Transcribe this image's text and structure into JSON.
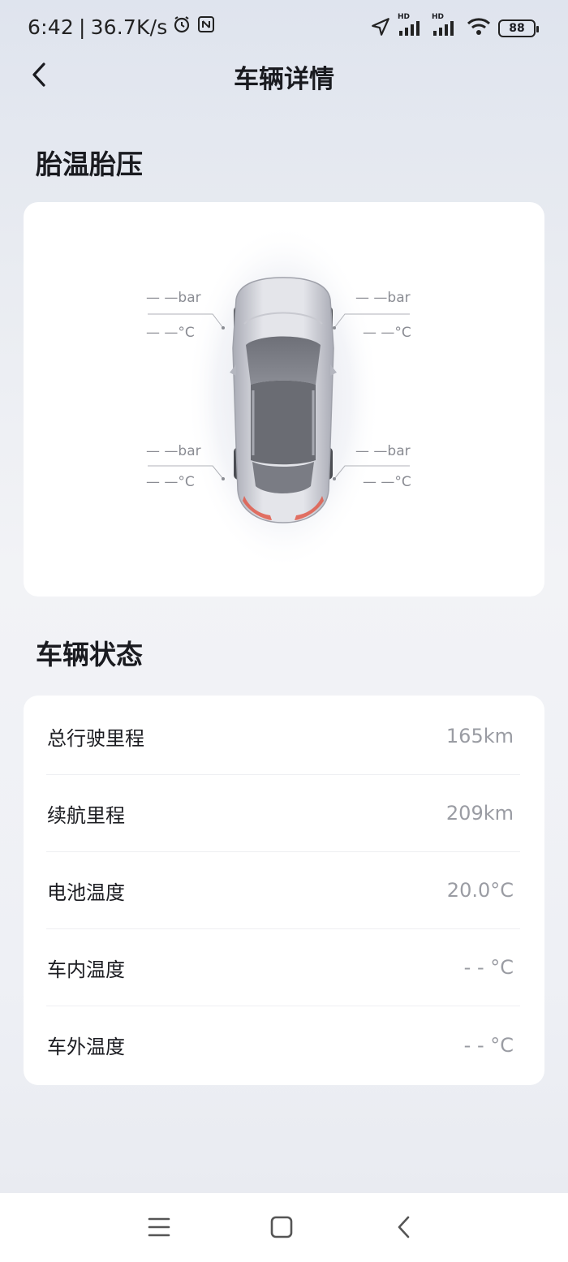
{
  "status_bar": {
    "time": "6:42",
    "net_speed": "36.7K/s",
    "battery": "88",
    "signal_badge_1": "HD",
    "signal_badge_2": "HD"
  },
  "header": {
    "title": "车辆详情"
  },
  "tire_section": {
    "title": "胎温胎压",
    "tires": [
      {
        "pressure": "— —bar",
        "temperature": "— —°C"
      },
      {
        "pressure": "— —bar",
        "temperature": "— —°C"
      },
      {
        "pressure": "— —bar",
        "temperature": "— —°C"
      },
      {
        "pressure": "— —bar",
        "temperature": "— —°C"
      }
    ]
  },
  "vehicle_status": {
    "title": "车辆状态",
    "rows": [
      {
        "label": "总行驶里程",
        "value": "165km"
      },
      {
        "label": "续航里程",
        "value": "209km"
      },
      {
        "label": "电池温度",
        "value": "20.0°C"
      },
      {
        "label": "车内温度",
        "value": "- - °C"
      },
      {
        "label": "车外温度",
        "value": "- - °C"
      }
    ]
  },
  "icons": {
    "back": "chevron-left-icon",
    "alarm": "alarm-icon",
    "nfc": "nfc-icon",
    "location": "location-arrow-icon",
    "wifi": "wifi-icon",
    "menu": "menu-icon",
    "home": "home-square-icon",
    "nav_back": "back-icon"
  },
  "colors": {
    "accent_tail_light": "#e05a4a",
    "secondary_text": "#9a9ca3"
  }
}
